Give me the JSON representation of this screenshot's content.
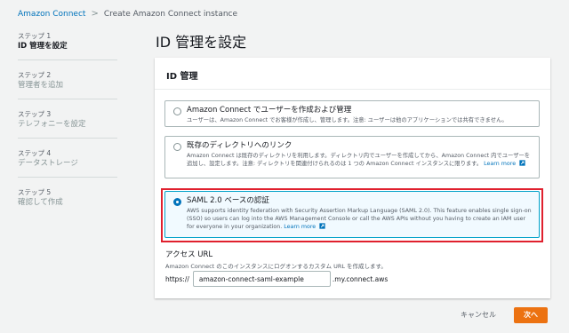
{
  "breadcrumb": {
    "root": "Amazon Connect",
    "separator": ">",
    "current": "Create Amazon Connect instance"
  },
  "steps": [
    {
      "number": "ステップ 1",
      "title": "ID 管理を設定",
      "active": true
    },
    {
      "number": "ステップ 2",
      "title": "管理者を追加",
      "active": false
    },
    {
      "number": "ステップ 3",
      "title": "テレフォニーを設定",
      "active": false
    },
    {
      "number": "ステップ 4",
      "title": "データストレージ",
      "active": false
    },
    {
      "number": "ステップ 5",
      "title": "確認して作成",
      "active": false
    }
  ],
  "page_title": "ID 管理を設定",
  "panel": {
    "header": "ID 管理",
    "options": [
      {
        "title": "Amazon Connect でユーザーを作成および管理",
        "description": "ユーザーは、Amazon Connect でお客様が作成し、管理します。注意: ユーザーは他のアプリケーションでは共有できません。",
        "selected": false
      },
      {
        "title": "既存のディレクトリへのリンク",
        "description": "Amazon Connect は既存のディレクトリを利用します。ディレクトリ内でユーザーを作成してから、Amazon Connect 内でユーザーを追加し、設定します。注意: ディレクトリを関連付けられるのは 1 つの Amazon Connect インスタンスに限ります。",
        "learn_more": "Learn more",
        "selected": false
      },
      {
        "title": "SAML 2.0 ベースの認証",
        "description": "AWS supports identity federation with Security Assertion Markup Language (SAML 2.0). This feature enables single sign-on (SSO) so users can log into the AWS Management Console or call the AWS APIs without you having to create an IAM user for everyone in your organization.",
        "learn_more": "Learn more",
        "selected": true
      }
    ],
    "access_url": {
      "label": "アクセス URL",
      "hint": "Amazon Connect のこのインスタンスにログオンするカスタム URL を作成します。",
      "prefix": "https://",
      "value": "amazon-connect-saml-example",
      "suffix": ".my.connect.aws"
    }
  },
  "buttons": {
    "cancel": "キャンセル",
    "next": "次へ"
  },
  "colors": {
    "accent": "#0073bb",
    "primary_button": "#ec7211",
    "highlight": "#e0202e"
  }
}
